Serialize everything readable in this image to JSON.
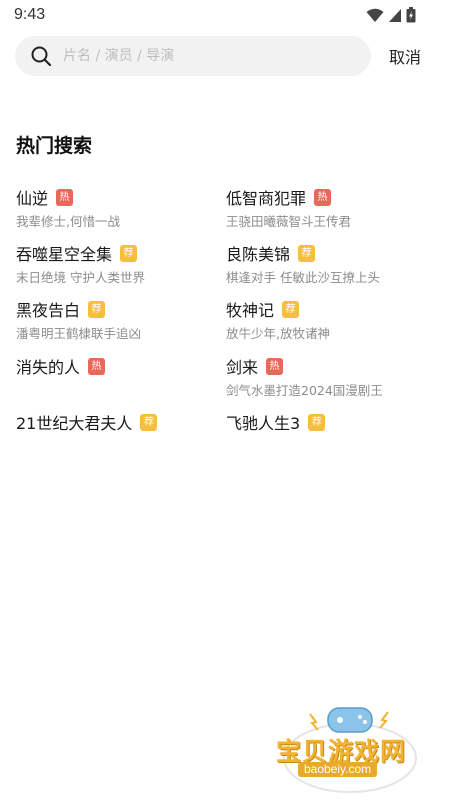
{
  "status_bar": {
    "time": "9:43"
  },
  "search": {
    "placeholder": "片名 / 演员 / 导演",
    "value": ""
  },
  "cancel_label": "取消",
  "section_title": "热门搜索",
  "badges": {
    "hot": "热",
    "recommend": "荐"
  },
  "hot_list": [
    {
      "name": "仙逆",
      "badge": "hot",
      "desc": "我辈修士,何惜一战"
    },
    {
      "name": "低智商犯罪",
      "badge": "hot",
      "desc": "王骁田曦薇智斗王传君"
    },
    {
      "name": "吞噬星空全集",
      "badge": "recommend",
      "desc": "末日绝境 守护人类世界"
    },
    {
      "name": "良陈美锦",
      "badge": "recommend",
      "desc": "棋逢对手 任敏此沙互撩上头"
    },
    {
      "name": "黑夜告白",
      "badge": "recommend",
      "desc": "潘粤明王鹤棣联手追凶"
    },
    {
      "name": "牧神记",
      "badge": "recommend",
      "desc": "放牛少年,放牧诸神"
    },
    {
      "name": "消失的人",
      "badge": "hot",
      "desc": ""
    },
    {
      "name": "剑来",
      "badge": "hot",
      "desc": "剑气水墨打造2024国漫剧王"
    },
    {
      "name": "21世纪大君夫人",
      "badge": "recommend",
      "desc": ""
    },
    {
      "name": "飞驰人生3",
      "badge": "recommend",
      "desc": ""
    }
  ],
  "watermark": {
    "title": "宝贝游戏网",
    "url": "baobeiy.com"
  },
  "colors": {
    "hot_badge": "#e8685a",
    "recommend_badge": "#f5be3d",
    "search_bg": "#f2f2f2"
  }
}
